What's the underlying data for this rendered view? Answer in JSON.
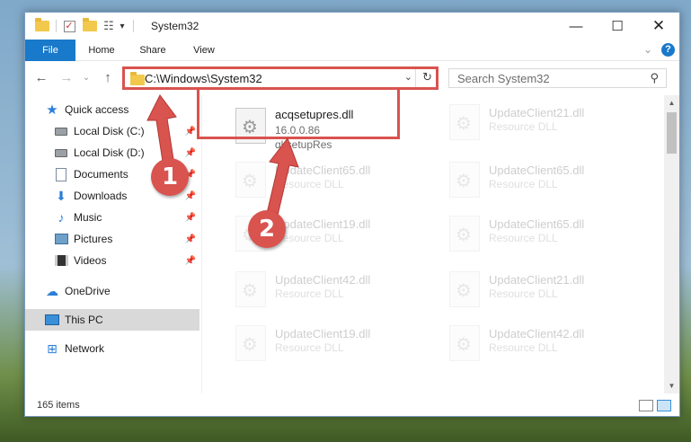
{
  "window": {
    "title": "System32"
  },
  "ribbon": {
    "tabs": [
      {
        "label": "File"
      },
      {
        "label": "Home"
      },
      {
        "label": "Share"
      },
      {
        "label": "View"
      }
    ]
  },
  "address": {
    "path": "C:\\Windows\\System32",
    "search_placeholder": "Search System32"
  },
  "sidebar": {
    "items": [
      {
        "label": "Quick access",
        "icon": "star-icon"
      },
      {
        "label": "Local Disk (C:)",
        "icon": "drive-icon",
        "pinned": true
      },
      {
        "label": "Local Disk (D:)",
        "icon": "drive-icon",
        "pinned": true
      },
      {
        "label": "Documents",
        "icon": "documents-icon",
        "pinned": true
      },
      {
        "label": "Downloads",
        "icon": "download-icon",
        "pinned": true
      },
      {
        "label": "Music",
        "icon": "music-icon",
        "pinned": true
      },
      {
        "label": "Pictures",
        "icon": "pictures-icon",
        "pinned": true
      },
      {
        "label": "Videos",
        "icon": "videos-icon",
        "pinned": true
      },
      {
        "label": "OneDrive",
        "icon": "cloud-icon"
      },
      {
        "label": "This PC",
        "icon": "computer-icon",
        "selected": true
      },
      {
        "label": "Network",
        "icon": "network-icon"
      }
    ]
  },
  "files": [
    {
      "name": "acqsetupres.dll",
      "version": "16.0.0.86",
      "desc": "qksetupRes",
      "highlighted": true
    },
    {
      "name": "UpdateClient21.dll",
      "type": "Resource DLL"
    },
    {
      "name": "UpdateClient65.dll",
      "type": "Resource DLL"
    },
    {
      "name": "UpdateClient65.dll",
      "type": "Resource DLL"
    },
    {
      "name": "UpdateClient19.dll",
      "type": "Resource DLL"
    },
    {
      "name": "UpdateClient65.dll",
      "type": "Resource DLL"
    },
    {
      "name": "UpdateClient42.dll",
      "type": "Resource DLL"
    },
    {
      "name": "UpdateClient21.dll",
      "type": "Resource DLL"
    },
    {
      "name": "UpdateClient19.dll",
      "type": "Resource DLL"
    },
    {
      "name": "UpdateClient42.dll",
      "type": "Resource DLL"
    }
  ],
  "status": {
    "item_count": "165 items"
  },
  "annotations": [
    {
      "label": "1"
    },
    {
      "label": "2"
    }
  ],
  "colors": {
    "accent": "#1979ca",
    "highlight": "#d9534f"
  }
}
